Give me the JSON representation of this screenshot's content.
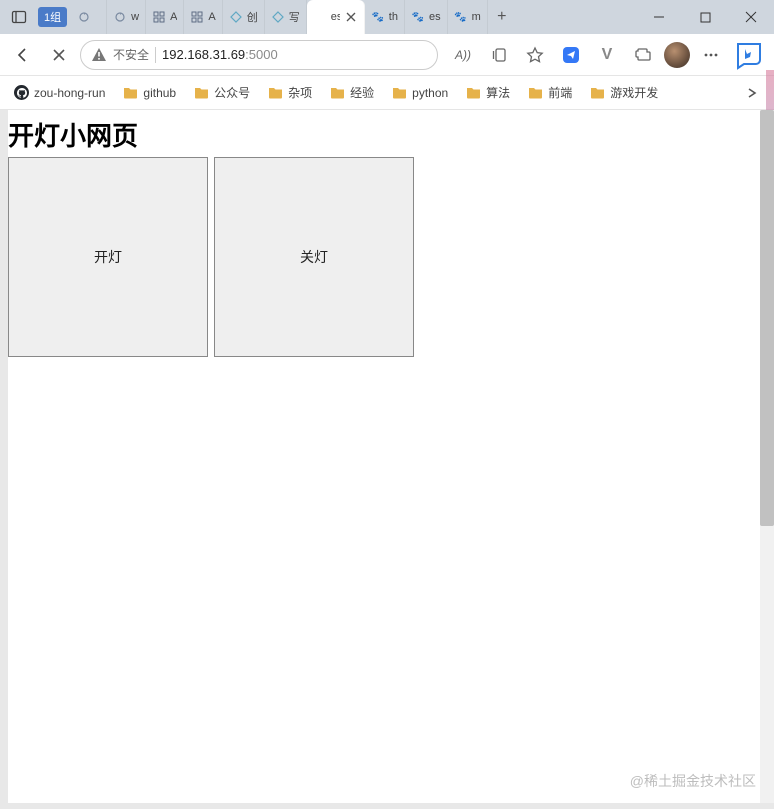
{
  "window": {
    "tab_group_label": "1组",
    "tabs": [
      {
        "label": "",
        "favicon": "refresh-double"
      },
      {
        "label": "w",
        "favicon": "refresh-double"
      },
      {
        "label": "A",
        "favicon": "grid"
      },
      {
        "label": "A",
        "favicon": "grid"
      },
      {
        "label": "创",
        "favicon": "diamond"
      },
      {
        "label": "写",
        "favicon": "diamond"
      },
      {
        "label": "es",
        "favicon": "blank",
        "active": true
      },
      {
        "label": "th",
        "favicon": "paw"
      },
      {
        "label": "es",
        "favicon": "paw"
      },
      {
        "label": "m",
        "favicon": "paw"
      }
    ]
  },
  "toolbar": {
    "security_label": "不安全",
    "url_host": "192.168.31.69",
    "url_port": ":5000",
    "reading_mode_label": "A))"
  },
  "bookmarks": [
    {
      "label": "zou-hong-run",
      "icon": "github"
    },
    {
      "label": "github",
      "icon": "folder"
    },
    {
      "label": "公众号",
      "icon": "folder"
    },
    {
      "label": "杂项",
      "icon": "folder"
    },
    {
      "label": "经验",
      "icon": "folder"
    },
    {
      "label": "python",
      "icon": "folder"
    },
    {
      "label": "算法",
      "icon": "folder"
    },
    {
      "label": "前端",
      "icon": "folder"
    },
    {
      "label": "游戏开发",
      "icon": "folder"
    }
  ],
  "page": {
    "heading": "开灯小网页",
    "button_on": "开灯",
    "button_off": "关灯"
  },
  "watermark": "@稀土掘金技术社区"
}
